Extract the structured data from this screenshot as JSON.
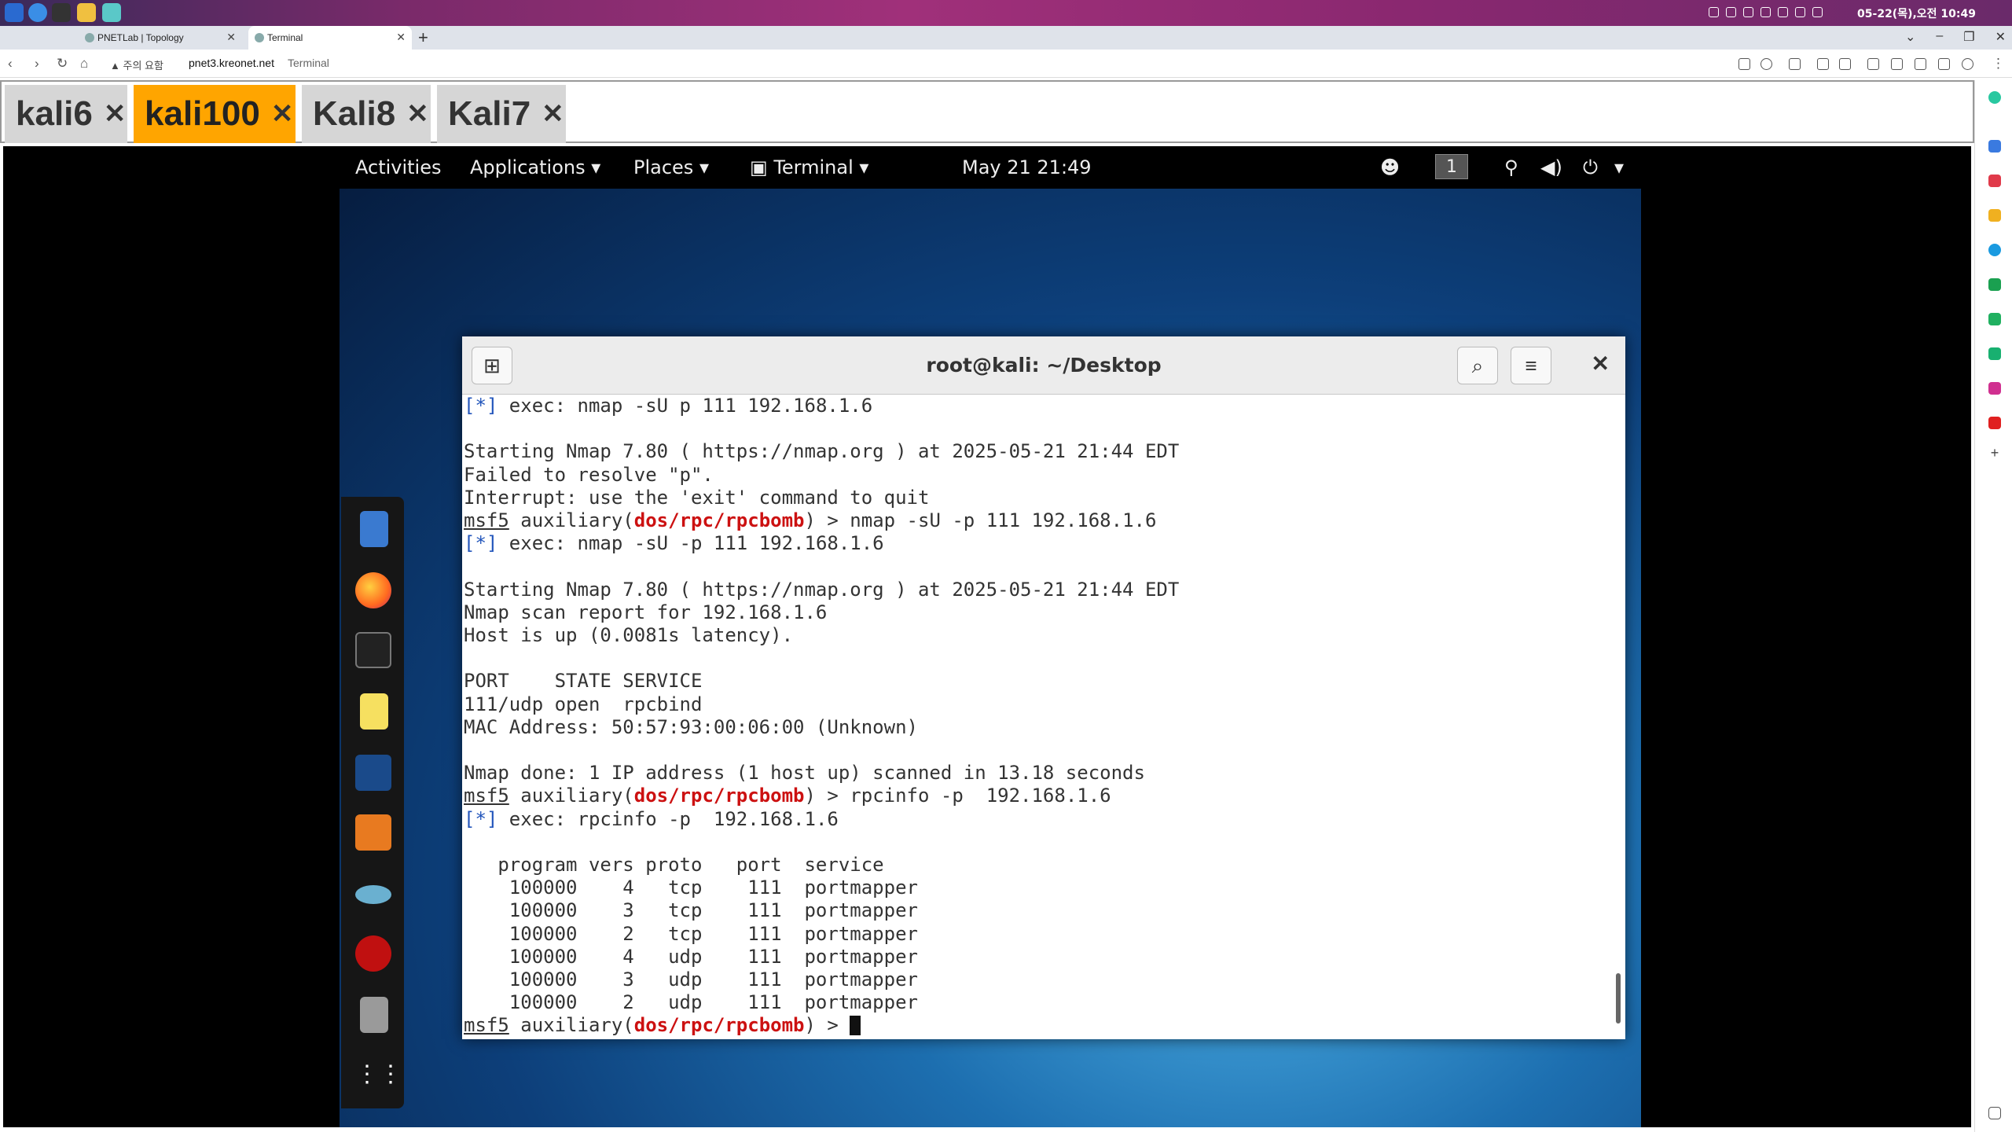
{
  "os": {
    "clock": "05-22(목),오전 10:49"
  },
  "browser": {
    "tabs": [
      {
        "label": "PNETLab | Topology",
        "active": false
      },
      {
        "label": "Terminal",
        "active": true
      }
    ],
    "security_label": "주의 요함",
    "url": "pnet3.kreonet.net",
    "page_title": "Terminal"
  },
  "app_tabs": [
    {
      "label": "kali6",
      "active": false
    },
    {
      "label": "kali100",
      "active": true
    },
    {
      "label": "Kali8",
      "active": false
    },
    {
      "label": "Kali7",
      "active": false
    }
  ],
  "gnome": {
    "activities": "Activities",
    "applications": "Applications",
    "places": "Places",
    "terminal_menu": "Terminal",
    "datetime": "May 21  21:49",
    "workspace": "1"
  },
  "terminal": {
    "title": "root@kali: ~/Desktop",
    "lines": [
      "Starting Nmap 7.80 ( https://nmap.org ) at 2025-05-21 21:44 EDT",
      "Failed to resolve \"p\".",
      "Interrupt: use the 'exit' command to quit",
      "Starting Nmap 7.80 ( https://nmap.org ) at 2025-05-21 21:44 EDT",
      "Nmap scan report for 192.168.1.6",
      "Host is up (0.0081s latency).",
      "PORT    STATE SERVICE",
      "111/udp open  rpcbind",
      "MAC Address: 50:57:93:00:06:00 (Unknown)",
      "Nmap done: 1 IP address (1 host up) scanned in 13.18 seconds",
      "   program vers proto   port  service",
      "    100000    4   tcp    111  portmapper",
      "    100000    3   tcp    111  portmapper",
      "    100000    2   tcp    111  portmapper",
      "    100000    4   udp    111  portmapper",
      "    100000    3   udp    111  portmapper",
      "    100000    2   udp    111  portmapper"
    ],
    "exec_marker": "[*]",
    "exec_1": " exec: nmap -sU p 111 192.168.1.6",
    "exec_2": " exec: nmap -sU -p 111 192.168.1.6",
    "exec_3": " exec: rpcinfo -p  192.168.1.6",
    "prompt_msf": "msf5",
    "prompt_aux": " auxiliary(",
    "prompt_module": "dos/rpc/rpcbomb",
    "prompt_end": ") > ",
    "cmd_1": "nmap -sU -p 111 192.168.1.6",
    "cmd_2": "rpcinfo -p  192.168.1.6"
  }
}
